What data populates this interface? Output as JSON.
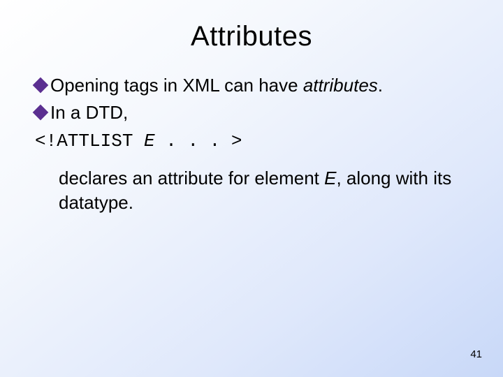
{
  "title": "Attributes",
  "bullet1_a": "Opening tags in XML can have ",
  "bullet1_b": "attributes",
  "bullet1_c": ".",
  "bullet2": "In a DTD,",
  "code_a": "<!ATTLIST ",
  "code_b": "E",
  "code_c": " . . . >",
  "sub_a": "declares an attribute for element ",
  "sub_b": "E",
  "sub_c": ", along with its datatype.",
  "pagenum": "41"
}
